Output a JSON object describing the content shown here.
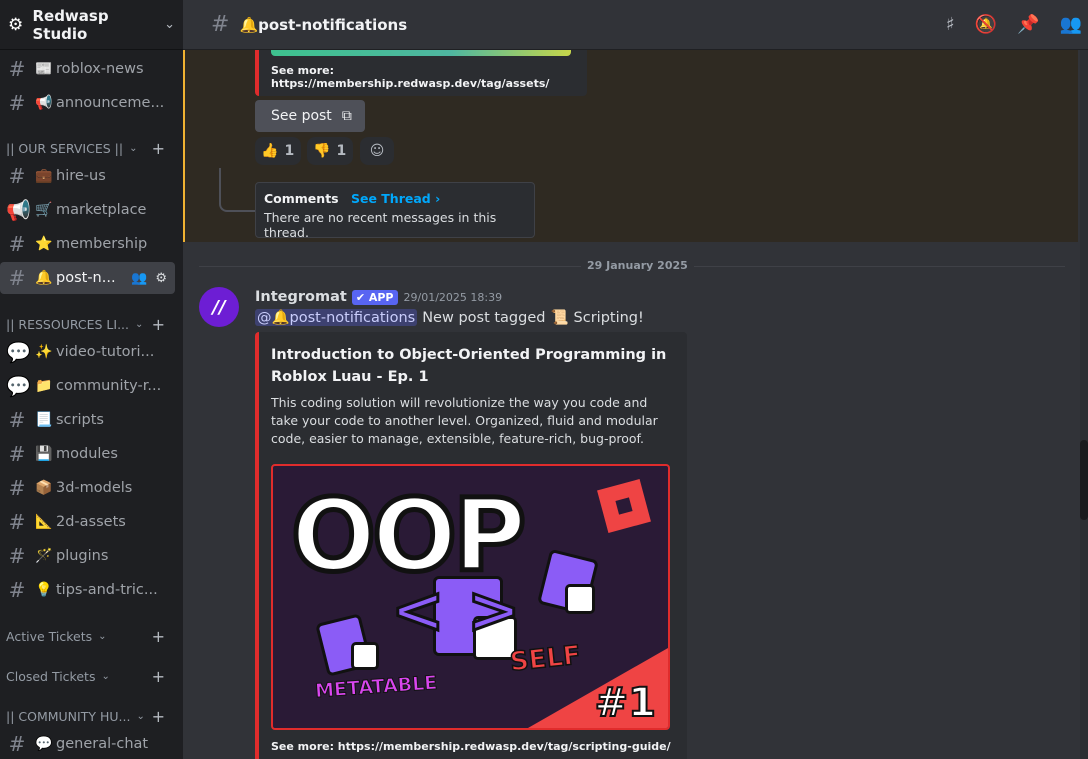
{
  "server": {
    "name": "Redwasp Studio"
  },
  "channels": [
    {
      "label": "roblox-news",
      "emoji": "📰"
    },
    {
      "label": "announceme...",
      "emoji": "📢"
    },
    {
      "label": "hire-us",
      "emoji": "💼"
    },
    {
      "label": "marketplace",
      "emoji": "🛒"
    },
    {
      "label": "membership",
      "emoji": "⭐"
    },
    {
      "label": "post-n...",
      "emoji": "🔔"
    },
    {
      "label": "video-tutori...",
      "emoji": "✨"
    },
    {
      "label": "community-r...",
      "emoji": "📁"
    },
    {
      "label": "scripts",
      "emoji": "📃"
    },
    {
      "label": "modules",
      "emoji": "💾"
    },
    {
      "label": "3d-models",
      "emoji": "📦"
    },
    {
      "label": "2d-assets",
      "emoji": "📐"
    },
    {
      "label": "plugins",
      "emoji": "🪄"
    },
    {
      "label": "tips-and-tric...",
      "emoji": "💡"
    },
    {
      "label": "general-chat",
      "emoji": "💬"
    }
  ],
  "categories": [
    {
      "label": "|| OUR SERVICES ||"
    },
    {
      "label": "|| RESSOURCES LI..."
    },
    {
      "label": "Active Tickets"
    },
    {
      "label": "Closed Tickets"
    },
    {
      "label": "|| COMMUNITY HU..."
    }
  ],
  "topbar": {
    "channel": "post-notifications",
    "emoji": "🔔"
  },
  "prev_embed": {
    "see_more": "See more: https://membership.redwasp.dev/tag/assets/"
  },
  "see_post": "See post",
  "reactions": [
    {
      "emoji": "👍",
      "count": "1"
    },
    {
      "emoji": "👎",
      "count": "1"
    }
  ],
  "thread": {
    "title": "Comments",
    "see": "See Thread ›",
    "body": "There are no recent messages in this thread."
  },
  "date_divider": "29 January 2025",
  "message": {
    "author": "Integromat",
    "app_tag": "✔ APP",
    "timestamp": "29/01/2025 18:39",
    "mention": "@🔔post-notifications",
    "text": "New post tagged",
    "tag_emoji": "📜",
    "tag": "Scripting!"
  },
  "embed": {
    "title": "Introduction to Object-Oriented Programming in Roblox Luau - Ep. 1",
    "description": "This coding solution will revolutionize the way you code and take your code to another level. Organized, fluid and modular code, easier to manage, extensible, feature-rich, bug-proof.",
    "image_text": {
      "oop": "OOP",
      "brackets": "<    >",
      "metatable": "METATABLE",
      "self": "SELF",
      "episode": "#1"
    },
    "see_more": "See more: https://membership.redwasp.dev/tag/scripting-guide/"
  },
  "colors": {
    "accent": "#5865f2",
    "embed_bar": "#e02c2c",
    "highlight_bar": "#f0b232"
  }
}
